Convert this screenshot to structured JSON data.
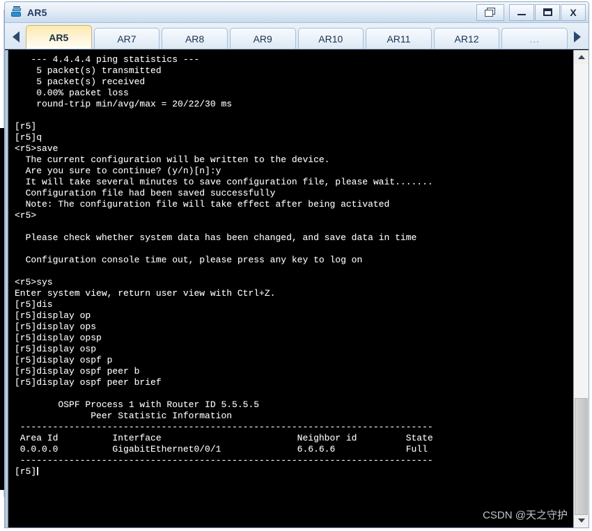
{
  "window": {
    "title": "AR5",
    "icon": "router-icon",
    "controls": [
      {
        "name": "restore-all-button",
        "label": "",
        "icon": "restore-windows-icon"
      },
      {
        "name": "minimize-button",
        "label": "_",
        "icon": "minimize-icon"
      },
      {
        "name": "maximize-button",
        "label": "",
        "icon": "maximize-icon"
      },
      {
        "name": "close-button",
        "label": "X",
        "icon": "close-icon"
      }
    ]
  },
  "tabbar": {
    "scroll_left_icon": "chevron-left-icon",
    "scroll_right_icon": "chevron-right-icon",
    "tabs": [
      {
        "label": "AR5",
        "active": true
      },
      {
        "label": "AR7",
        "active": false
      },
      {
        "label": "AR8",
        "active": false
      },
      {
        "label": "AR9",
        "active": false
      },
      {
        "label": "AR10",
        "active": false
      },
      {
        "label": "AR11",
        "active": false
      },
      {
        "label": "AR12",
        "active": false
      },
      {
        "label": "...",
        "active": false
      }
    ]
  },
  "terminal": {
    "background": "#000000",
    "foreground": "#ffffff",
    "prompt_cursor": true,
    "lines": [
      "   --- 4.4.4.4 ping statistics ---",
      "    5 packet(s) transmitted",
      "    5 packet(s) received",
      "    0.00% packet loss",
      "    round-trip min/avg/max = 20/22/30 ms",
      "",
      "[r5]",
      "[r5]q",
      "<r5>save",
      "  The current configuration will be written to the device.",
      "  Are you sure to continue? (y/n)[n]:y",
      "  It will take several minutes to save configuration file, please wait.......",
      "  Configuration file had been saved successfully",
      "  Note: The configuration file will take effect after being activated",
      "<r5>",
      "",
      "  Please check whether system data has been changed, and save data in time",
      "",
      "  Configuration console time out, please press any key to log on",
      "",
      "<r5>sys",
      "Enter system view, return user view with Ctrl+Z.",
      "[r5]dis",
      "[r5]display op",
      "[r5]display ops",
      "[r5]display opsp",
      "[r5]display osp",
      "[r5]display ospf p",
      "[r5]display ospf peer b",
      "[r5]display ospf peer brief",
      "",
      "        OSPF Process 1 with Router ID 5.5.5.5",
      "              Peer Statistic Information",
      " ----------------------------------------------------------------------------",
      " Area Id          Interface                         Neighbor id         State",
      " 0.0.0.0          GigabitEthernet0/0/1              6.6.6.6             Full",
      " ----------------------------------------------------------------------------"
    ],
    "last_prompt": "[r5]"
  },
  "watermark": {
    "text": "CSDN @天之守护"
  },
  "scrollbar": {
    "up_icon": "caret-up-icon",
    "down_icon": "caret-down-icon"
  },
  "colors": {
    "titlebar_top": "#f3f7fc",
    "titlebar_bottom": "#c8dbef",
    "active_tab": "#fde9ad",
    "terminal_bg": "#000000",
    "terminal_fg": "#ffffff",
    "frame_border": "#8da9c8"
  }
}
